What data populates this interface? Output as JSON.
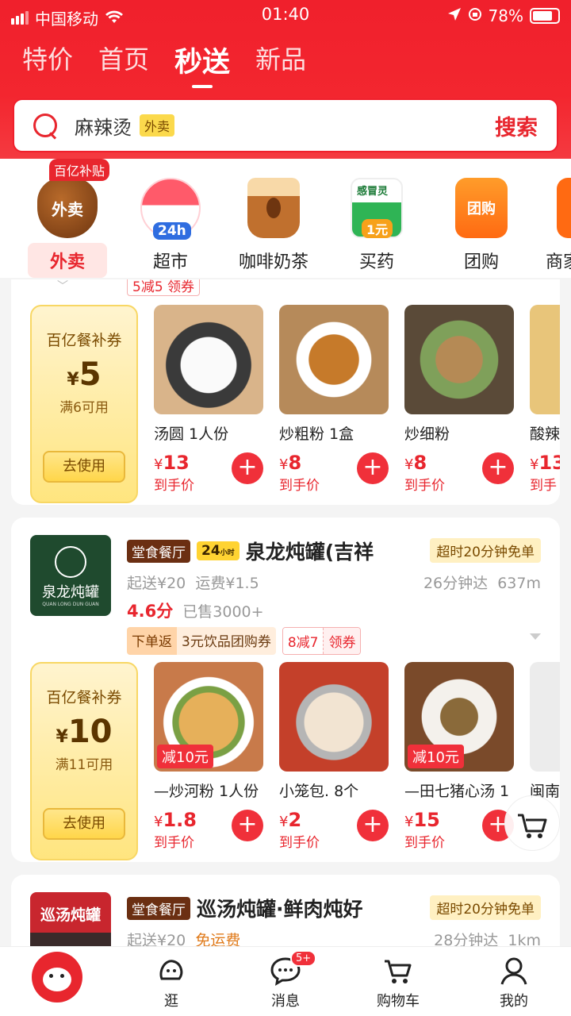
{
  "status": {
    "carrier": "中国移动",
    "time": "01:40",
    "battery": "78%"
  },
  "tabs": [
    "特价",
    "首页",
    "秒送",
    "新品"
  ],
  "search": {
    "query": "麻辣烫",
    "tag": "外卖",
    "button": "搜索"
  },
  "categories": [
    {
      "label": "外卖",
      "icon_text": "外卖",
      "badge": "百亿补贴"
    },
    {
      "label": "超市",
      "icon_text": "24h"
    },
    {
      "label": "咖啡奶茶",
      "icon_text": ""
    },
    {
      "label": "买药",
      "icon_text": "1元",
      "icon_top": "感冒灵"
    },
    {
      "label": "团购",
      "icon_text": "团购"
    },
    {
      "label": "商家",
      "icon_text": ""
    }
  ],
  "card1": {
    "coupon": {
      "title": "百亿餐补券",
      "currency": "¥",
      "value": "5",
      "cond": "满6可用",
      "btn": "去使用"
    },
    "top_promo": "5减5 领券",
    "items": [
      {
        "name": "汤圆 1人份",
        "price": "13",
        "sub": "到手价"
      },
      {
        "name": "炒粗粉 1盒",
        "price": "8",
        "sub": "到手价"
      },
      {
        "name": "炒细粉",
        "price": "8",
        "sub": "到手价"
      },
      {
        "name": "酸辣",
        "price": "13",
        "sub": "到手"
      }
    ]
  },
  "card2": {
    "logo_text": "泉龙炖罐",
    "logo_sub": "QUAN LONG DUN GUAN",
    "badge1": "堂食餐厅",
    "badge2": "24",
    "badge2_small": "小时",
    "name": "泉龙炖罐(吉祥",
    "free": "超时20分钟免单",
    "min": "起送¥20",
    "fee": "运费¥1.5",
    "time": "26分钟达",
    "dist": "637m",
    "rating": "4.6分",
    "sold": "已售3000+",
    "promo1a": "下单返",
    "promo1b": "3元饮品团购券",
    "promo2a": "8减7",
    "promo2b": "领券",
    "coupon": {
      "title": "百亿餐补券",
      "currency": "¥",
      "value": "10",
      "cond": "满11可用",
      "btn": "去使用"
    },
    "items": [
      {
        "name": "—炒河粉 1人份",
        "price": "1.8",
        "sub": "到手价",
        "disc": "减10元"
      },
      {
        "name": "小笼包. 8个",
        "price": "2",
        "sub": "到手价",
        "disc": ""
      },
      {
        "name": "—田七猪心汤 1",
        "price": "15",
        "sub": "到手价",
        "disc": "减10元"
      },
      {
        "name": "闽南",
        "price": "",
        "sub": "",
        "disc": ""
      }
    ]
  },
  "card3": {
    "logo_text": "巡汤炖罐",
    "badge1": "堂食餐厅",
    "name": "巡汤炖罐·鲜肉炖好",
    "free": "超时20分钟免单",
    "min": "起送¥20",
    "fee": "免运费",
    "time": "28分钟达",
    "dist": "1km"
  },
  "nav": [
    {
      "label": ""
    },
    {
      "label": "逛"
    },
    {
      "label": "消息",
      "badge": "5+"
    },
    {
      "label": "购物车"
    },
    {
      "label": "我的"
    }
  ],
  "colors": {
    "brand": "#f0202c",
    "accent": "#e8262e",
    "coupon": "#ffe57f"
  }
}
